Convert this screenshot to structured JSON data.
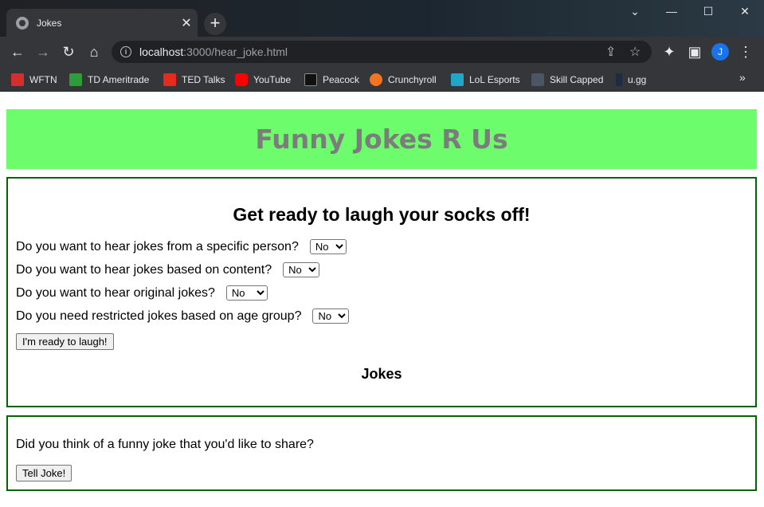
{
  "browser": {
    "tab_title": "Jokes",
    "new_tab": "+",
    "close_tab": "✕",
    "url_host": "localhost",
    "url_path": ":3000/hear_joke.html",
    "profile_initial": "J",
    "window_controls": {
      "chevron": "⌄",
      "minimize": "—",
      "maximize": "☐",
      "close": "✕"
    }
  },
  "bookmarks": [
    {
      "label": "WFTN",
      "color": "#d32f2f"
    },
    {
      "label": "TD Ameritrade",
      "color": "#2e9c3b"
    },
    {
      "label": "TED Talks",
      "color": "#e62b1e"
    },
    {
      "label": "YouTube",
      "color": "#ff0000"
    },
    {
      "label": "Peacock",
      "color": "#111111"
    },
    {
      "label": "Crunchyroll",
      "color": "#f47521"
    },
    {
      "label": "LoL Esports",
      "color": "#1ea7c6"
    },
    {
      "label": "Skill Capped",
      "color": "#4b5563"
    },
    {
      "label": "u.gg",
      "color": "#1f2a44"
    }
  ],
  "bookmarks_more": "»",
  "page": {
    "banner_title": "Funny Jokes R Us",
    "intro_heading": "Get ready to laugh your socks off!",
    "questions": [
      {
        "label": "Do you want to hear jokes from a specific person?",
        "value": "No"
      },
      {
        "label": "Do you want to hear jokes based on content?",
        "value": "No"
      },
      {
        "label": "Do you want to hear original jokes?",
        "value": "No"
      },
      {
        "label": "Do you need restricted jokes based on age group?",
        "value": "No"
      }
    ],
    "ready_button": "I'm ready to laugh!",
    "jokes_heading": "Jokes",
    "share_prompt": "Did you think of a funny joke that you'd like to share?",
    "tell_button": "Tell Joke!"
  },
  "colors": {
    "banner_bg": "#6cfc6c",
    "banner_text": "#7c7c7c",
    "box_border": "#006400"
  }
}
